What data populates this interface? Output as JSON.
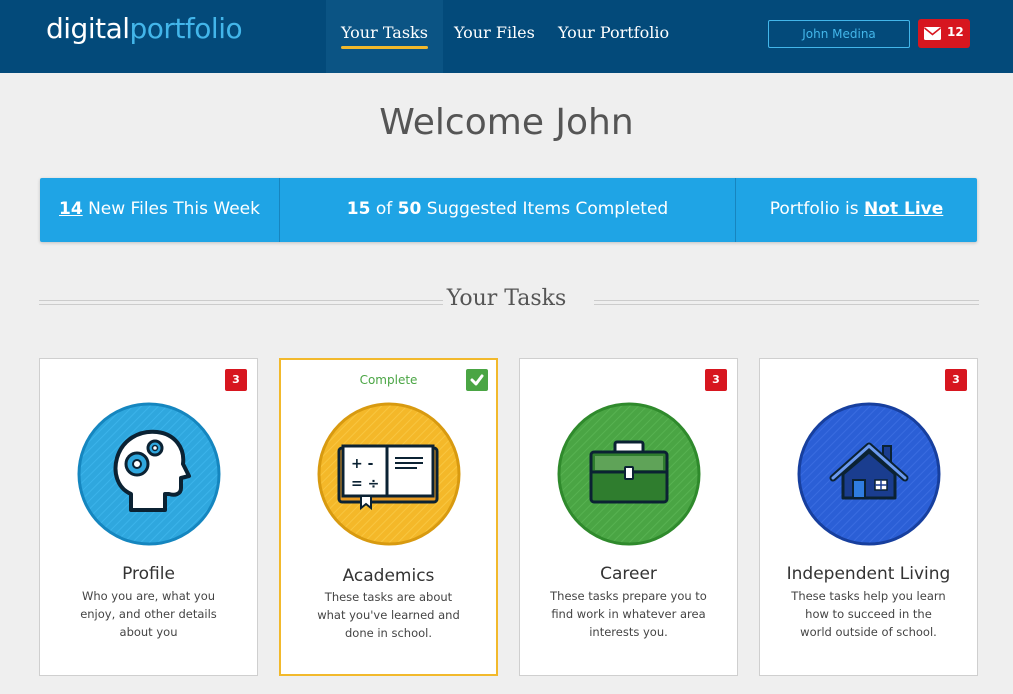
{
  "header": {
    "logo_part1": "digital",
    "logo_part2": "portfolio",
    "tabs": [
      {
        "label": "Your Tasks",
        "active": true
      },
      {
        "label": "Your Files",
        "active": false
      },
      {
        "label": "Your Portfolio",
        "active": false
      }
    ],
    "user_name": "John Medina",
    "mail_count": "12",
    "colors": {
      "bar": "#034a7a",
      "accent": "#43b6ea",
      "alert": "#d7161f",
      "underline": "#f2b92c"
    }
  },
  "welcome": "Welcome John",
  "stats": {
    "new_files_count": "14",
    "new_files_text": "New Files This Week",
    "completed_count": "15",
    "of_text": "of",
    "total_count": "50",
    "completed_text": "Suggested Items Completed",
    "portfolio_text": "Portfolio is",
    "portfolio_status": "Not Live"
  },
  "section_title": "Your Tasks",
  "cards": [
    {
      "title": "Profile",
      "description": "Who you are, what you enjoy, and other details about you",
      "badge": "3",
      "icon": "head-gears-icon",
      "color": "#2fa7de"
    },
    {
      "title": "Academics",
      "description": "These tasks are about what you've learned and done in school.",
      "status": "Complete",
      "icon": "open-book-icon",
      "color": "#f4b829"
    },
    {
      "title": "Career",
      "description": "These tasks prepare you to find work in whatever area interests you.",
      "badge": "3",
      "icon": "briefcase-icon",
      "color": "#4aa544"
    },
    {
      "title": "Independent Living",
      "description": "These tasks help you learn how to succeed in the world outside of school.",
      "badge": "3",
      "icon": "house-icon",
      "color": "#2b5fd6"
    }
  ]
}
